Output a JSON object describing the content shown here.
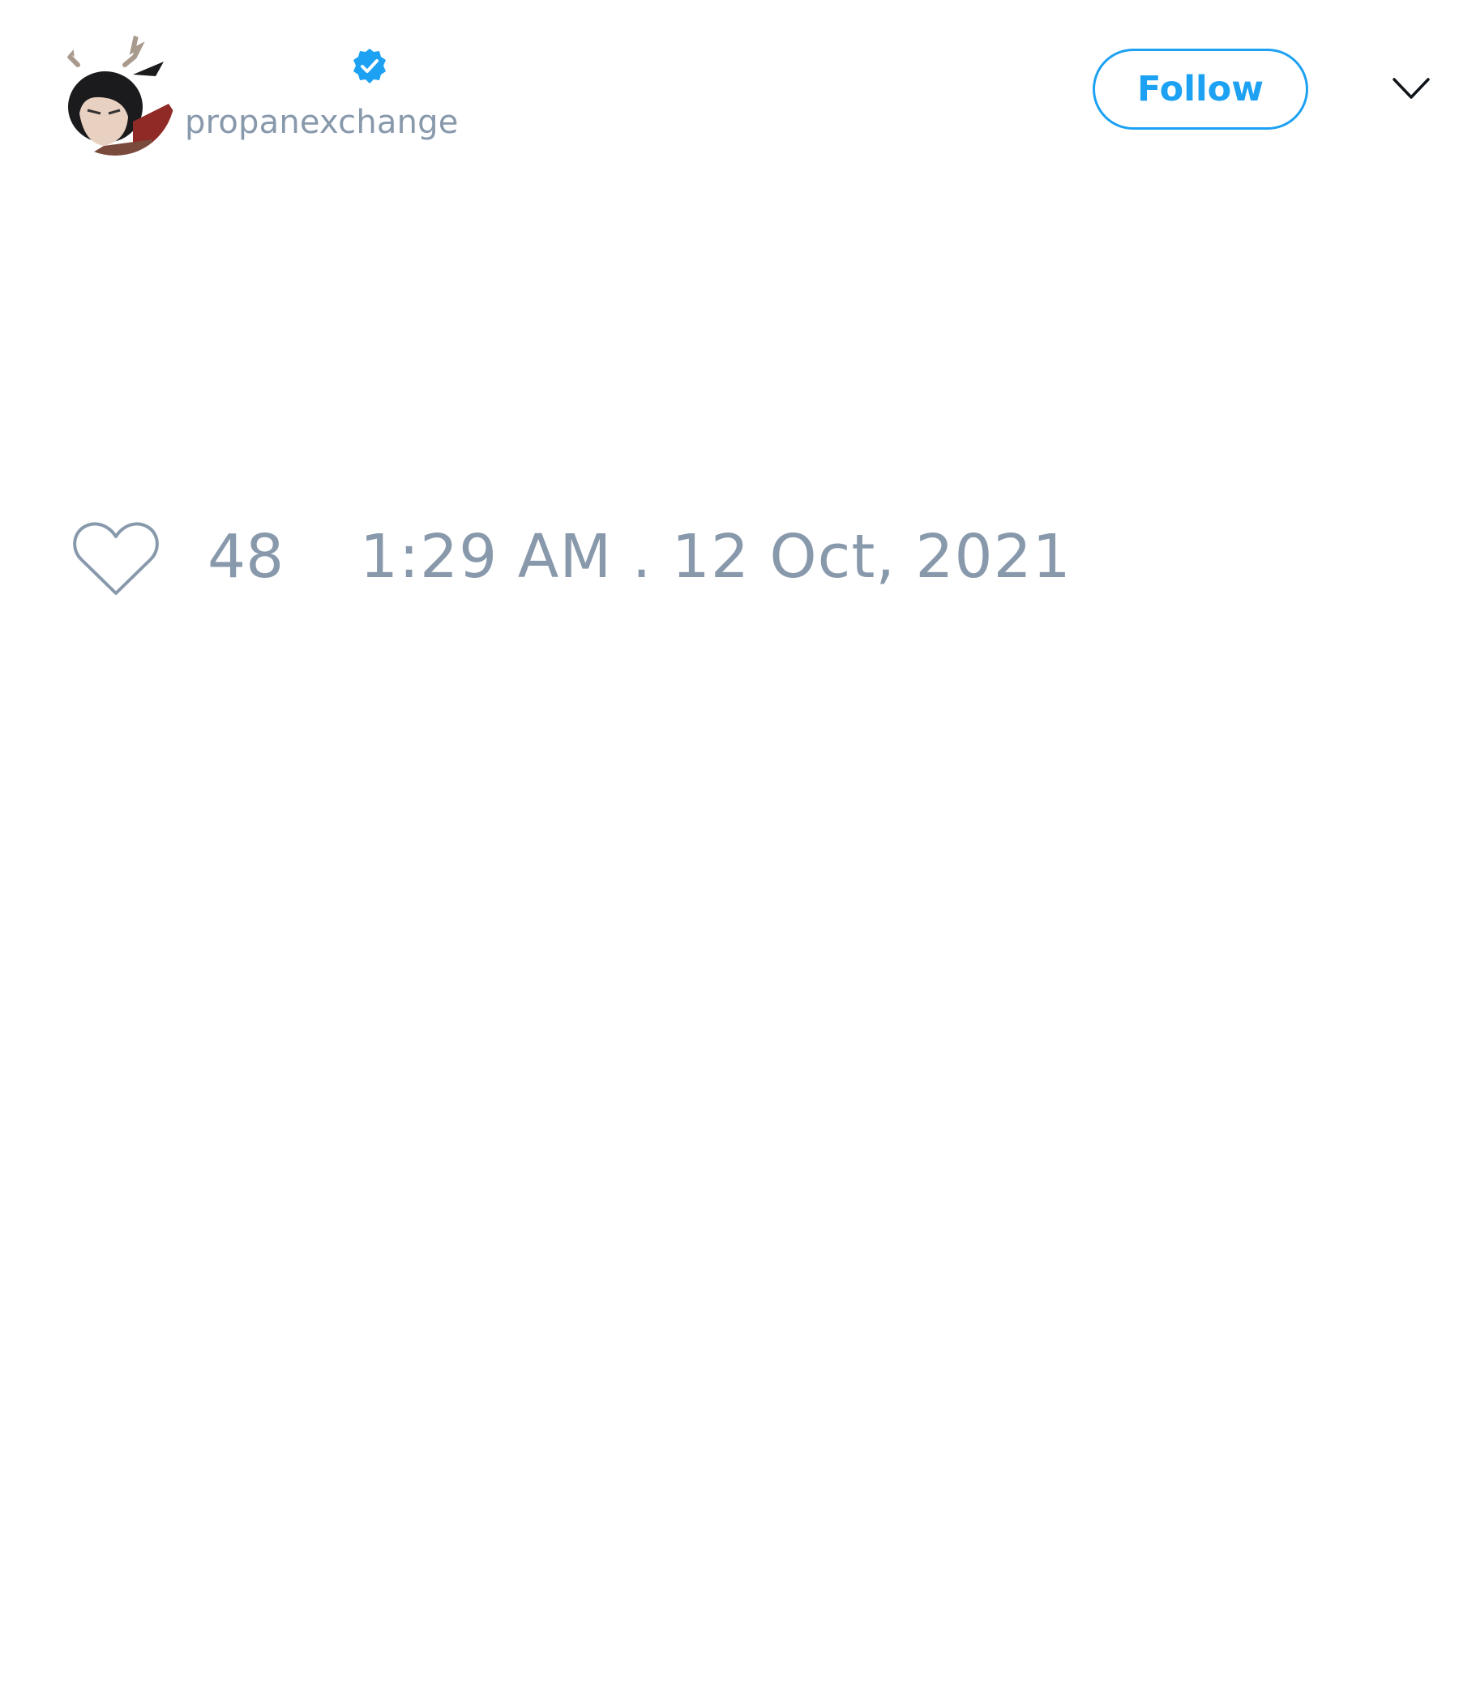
{
  "tweet": {
    "author": {
      "display_name": "",
      "username": "propanexchange",
      "verified": true,
      "avatar_icon": "avatar-anime-character-with-antlers"
    },
    "follow_button_label": "Follow",
    "menu_icon": "chevron-down-icon",
    "like_icon": "heart-outline-icon",
    "like_count": "48",
    "timestamp": "1:29 AM . 12 Oct, 2021"
  },
  "colors": {
    "accent": "#1da1f2",
    "muted_text": "#8899ac",
    "background": "#ffffff"
  }
}
